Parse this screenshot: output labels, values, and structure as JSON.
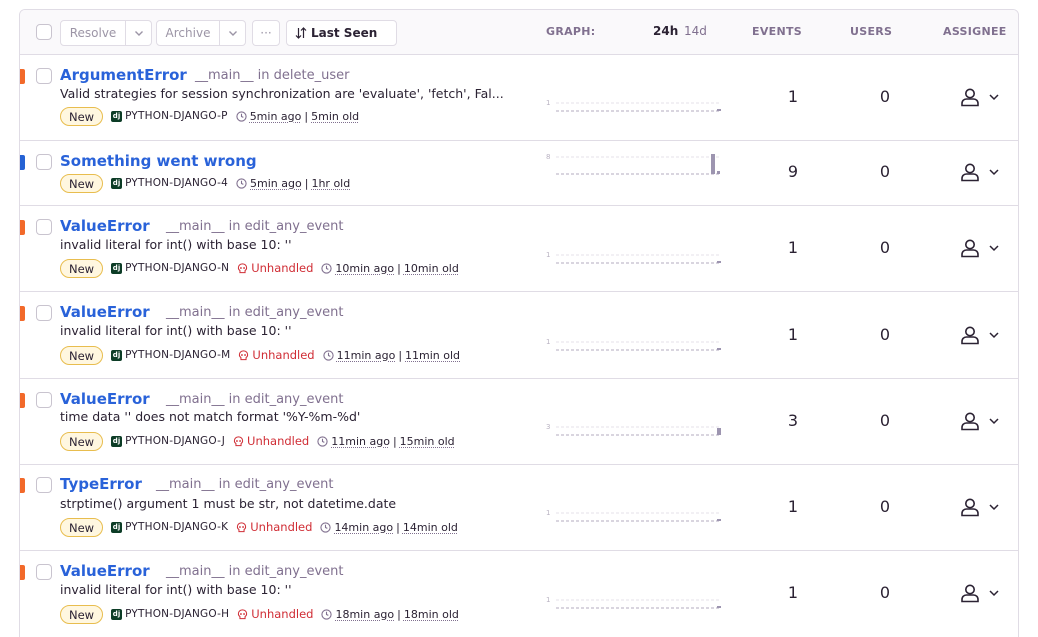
{
  "toolbar": {
    "resolve_label": "Resolve",
    "archive_label": "Archive",
    "more_label": "···",
    "sort_label": "Last Seen"
  },
  "header": {
    "graph": "GRAPH:",
    "tab_24h": "24h",
    "tab_14d": "14d",
    "events": "EVENTS",
    "users": "USERS",
    "assignee": "ASSIGNEE"
  },
  "colors": {
    "link": "#2962d9",
    "error_level": "#f2692a",
    "info_level": "#2562d4",
    "unhandled": "#d02d35",
    "badge_border": "#e8bd4e"
  },
  "issues": [
    {
      "title": "ArgumentError",
      "culprit": "__main__",
      "in_label": "in",
      "function": "delete_user",
      "message": "Valid strategies for session synchronization are 'evaluate', 'fetch', Fal...",
      "badge": "New",
      "project": "PYTHON-DJANGO-P",
      "unhandled": "",
      "last_seen": "5min ago",
      "age": "5min old",
      "events": "1",
      "users": "0",
      "graph_max": "1",
      "level": "error"
    },
    {
      "title": "Something went wrong",
      "culprit": "",
      "in_label": "",
      "function": "",
      "message": "",
      "badge": "New",
      "project": "PYTHON-DJANGO-4",
      "unhandled": "",
      "last_seen": "5min ago",
      "age": "1hr old",
      "events": "9",
      "users": "0",
      "graph_max": "8",
      "level": "info"
    },
    {
      "title": "ValueError",
      "culprit": "__main__",
      "in_label": "in",
      "function": "edit_any_event",
      "message": "invalid literal for int() with base 10: ''",
      "badge": "New",
      "project": "PYTHON-DJANGO-N",
      "unhandled": "Unhandled",
      "last_seen": "10min ago",
      "age": "10min old",
      "events": "1",
      "users": "0",
      "graph_max": "1",
      "level": "error"
    },
    {
      "title": "ValueError",
      "culprit": "__main__",
      "in_label": "in",
      "function": "edit_any_event",
      "message": "invalid literal for int() with base 10: ''",
      "badge": "New",
      "project": "PYTHON-DJANGO-M",
      "unhandled": "Unhandled",
      "last_seen": "11min ago",
      "age": "11min old",
      "events": "1",
      "users": "0",
      "graph_max": "1",
      "level": "error"
    },
    {
      "title": "ValueError",
      "culprit": "__main__",
      "in_label": "in",
      "function": "edit_any_event",
      "message": "time data '' does not match format '%Y-%m-%d'",
      "badge": "New",
      "project": "PYTHON-DJANGO-J",
      "unhandled": "Unhandled",
      "last_seen": "11min ago",
      "age": "15min old",
      "events": "3",
      "users": "0",
      "graph_max": "3",
      "level": "error"
    },
    {
      "title": "TypeError",
      "culprit": "__main__",
      "in_label": "in",
      "function": "edit_any_event",
      "message": "strptime() argument 1 must be str, not datetime.date",
      "badge": "New",
      "project": "PYTHON-DJANGO-K",
      "unhandled": "Unhandled",
      "last_seen": "14min ago",
      "age": "14min old",
      "events": "1",
      "users": "0",
      "graph_max": "1",
      "level": "error"
    },
    {
      "title": "ValueError",
      "culprit": "__main__",
      "in_label": "in",
      "function": "edit_any_event",
      "message": "invalid literal for int() with base 10: ''",
      "badge": "New",
      "project": "PYTHON-DJANGO-H",
      "unhandled": "Unhandled",
      "last_seen": "18min ago",
      "age": "18min old",
      "events": "1",
      "users": "0",
      "graph_max": "1",
      "level": "error"
    }
  ]
}
